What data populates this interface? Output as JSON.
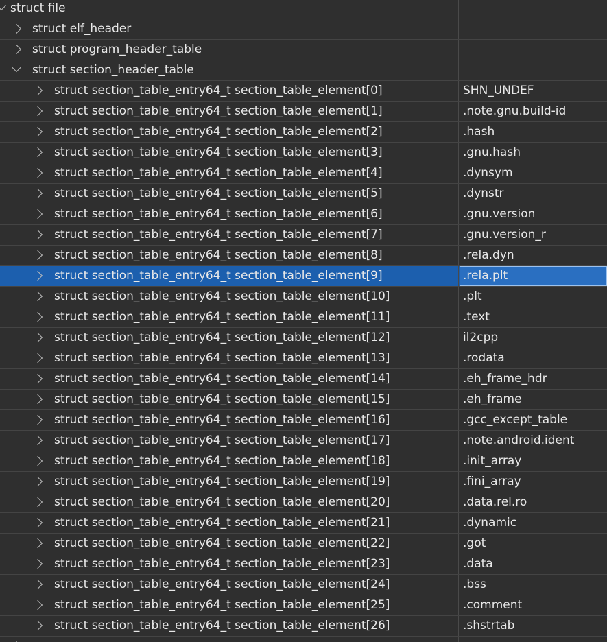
{
  "tree": {
    "root": {
      "label": "struct file",
      "value": ""
    },
    "level1": [
      {
        "label": "struct elf_header",
        "expanded": false,
        "value": ""
      },
      {
        "label": "struct program_header_table",
        "expanded": false,
        "value": ""
      },
      {
        "label": "struct section_header_table",
        "expanded": true,
        "value": ""
      }
    ],
    "entries": [
      {
        "label": "struct section_table_entry64_t section_table_element[0]",
        "value": "SHN_UNDEF"
      },
      {
        "label": "struct section_table_entry64_t section_table_element[1]",
        "value": ".note.gnu.build-id"
      },
      {
        "label": "struct section_table_entry64_t section_table_element[2]",
        "value": ".hash"
      },
      {
        "label": "struct section_table_entry64_t section_table_element[3]",
        "value": ".gnu.hash"
      },
      {
        "label": "struct section_table_entry64_t section_table_element[4]",
        "value": ".dynsym"
      },
      {
        "label": "struct section_table_entry64_t section_table_element[5]",
        "value": ".dynstr"
      },
      {
        "label": "struct section_table_entry64_t section_table_element[6]",
        "value": ".gnu.version"
      },
      {
        "label": "struct section_table_entry64_t section_table_element[7]",
        "value": ".gnu.version_r"
      },
      {
        "label": "struct section_table_entry64_t section_table_element[8]",
        "value": ".rela.dyn"
      },
      {
        "label": "struct section_table_entry64_t section_table_element[9]",
        "value": ".rela.plt",
        "selected": true
      },
      {
        "label": "struct section_table_entry64_t section_table_element[10]",
        "value": ".plt"
      },
      {
        "label": "struct section_table_entry64_t section_table_element[11]",
        "value": ".text"
      },
      {
        "label": "struct section_table_entry64_t section_table_element[12]",
        "value": "il2cpp"
      },
      {
        "label": "struct section_table_entry64_t section_table_element[13]",
        "value": ".rodata"
      },
      {
        "label": "struct section_table_entry64_t section_table_element[14]",
        "value": ".eh_frame_hdr"
      },
      {
        "label": "struct section_table_entry64_t section_table_element[15]",
        "value": ".eh_frame"
      },
      {
        "label": "struct section_table_entry64_t section_table_element[16]",
        "value": ".gcc_except_table"
      },
      {
        "label": "struct section_table_entry64_t section_table_element[17]",
        "value": ".note.android.ident"
      },
      {
        "label": "struct section_table_entry64_t section_table_element[18]",
        "value": ".init_array"
      },
      {
        "label": "struct section_table_entry64_t section_table_element[19]",
        "value": ".fini_array"
      },
      {
        "label": "struct section_table_entry64_t section_table_element[20]",
        "value": ".data.rel.ro"
      },
      {
        "label": "struct section_table_entry64_t section_table_element[21]",
        "value": ".dynamic"
      },
      {
        "label": "struct section_table_entry64_t section_table_element[22]",
        "value": ".got"
      },
      {
        "label": "struct section_table_entry64_t section_table_element[23]",
        "value": ".data"
      },
      {
        "label": "struct section_table_entry64_t section_table_element[24]",
        "value": ".bss"
      },
      {
        "label": "struct section_table_entry64_t section_table_element[25]",
        "value": ".comment"
      },
      {
        "label": "struct section_table_entry64_t section_table_element[26]",
        "value": ".shstrtab"
      }
    ]
  },
  "colors": {
    "background": "#2f2f2f",
    "selection": "#1c5fae",
    "text": "#e8e8e8"
  }
}
